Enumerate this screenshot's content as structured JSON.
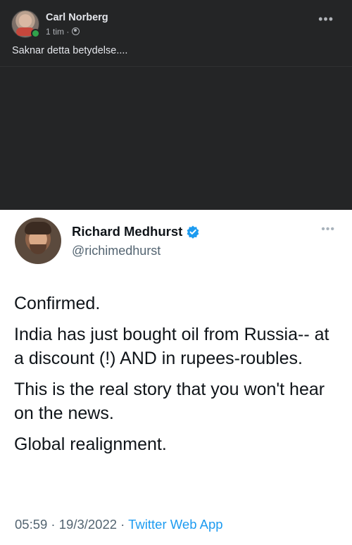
{
  "facebook_post": {
    "author": "Carl Norberg",
    "time": "1 tim ·",
    "text": "Saknar detta betydelse....",
    "more_icon": "ellipsis-icon",
    "privacy_icon": "globe-icon",
    "online_color": "#31a24c"
  },
  "tweet": {
    "name": "Richard Medhurst",
    "handle": "@richimedhurst",
    "verified_color": "#1d9bf0",
    "paragraphs": [
      "Confirmed.",
      "India has just bought oil from Russia-- at a discount (!) AND in rupees-roubles.",
      "This is the real story that you won't hear on the news.",
      "Global realignment."
    ],
    "timestamp": "05:59 · 19/3/2022 · ",
    "source": "Twitter Web App"
  }
}
